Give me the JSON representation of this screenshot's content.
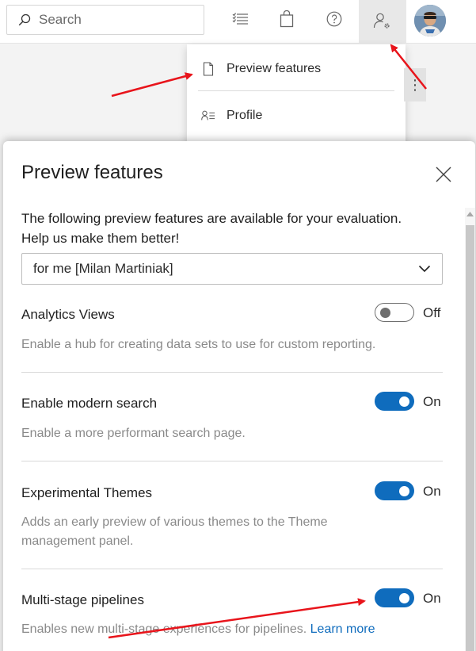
{
  "topbar": {
    "search_placeholder": "Search"
  },
  "menu": {
    "items": [
      {
        "label": "Preview features",
        "icon": "document-icon"
      },
      {
        "label": "Profile",
        "icon": "profile-icon"
      }
    ]
  },
  "panel": {
    "title": "Preview features",
    "intro": "The following preview features are available for your evaluation. Help us make them better!",
    "scope_select": "for me [Milan Martiniak]",
    "features": [
      {
        "name": "Analytics Views",
        "description": "Enable a hub for creating data sets to use for custom reporting.",
        "state": "Off",
        "enabled": false
      },
      {
        "name": "Enable modern search",
        "description": "Enable a more performant search page.",
        "state": "On",
        "enabled": true
      },
      {
        "name": "Experimental Themes",
        "description": "Adds an early preview of various themes to the Theme management panel.",
        "state": "On",
        "enabled": true
      },
      {
        "name": "Multi-stage pipelines",
        "description": "Enables new multi-stage experiences for pipelines.",
        "link": "Learn more",
        "state": "On",
        "enabled": true
      }
    ]
  },
  "colors": {
    "accent": "#0f6cbd",
    "annotation_arrow": "#e8141b"
  }
}
